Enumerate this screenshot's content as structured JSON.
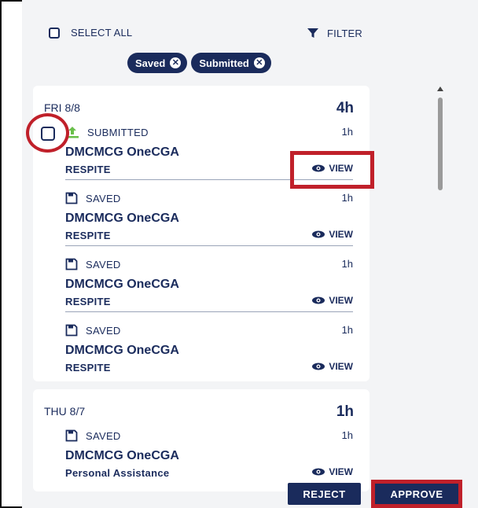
{
  "toolbar": {
    "select_all_label": "SELECT ALL",
    "filter_label": "FILTER"
  },
  "filter_chips": [
    {
      "label": "Saved"
    },
    {
      "label": "Submitted"
    }
  ],
  "days": [
    {
      "day": "FRI 8/8",
      "total": "4h",
      "entries": [
        {
          "status": "SUBMITTED",
          "hours": "1h",
          "name": "DMCMCG OneCGA",
          "service": "RESPITE",
          "view_label": "VIEW"
        },
        {
          "status": "SAVED",
          "hours": "1h",
          "name": "DMCMCG OneCGA",
          "service": "RESPITE",
          "view_label": "VIEW"
        },
        {
          "status": "SAVED",
          "hours": "1h",
          "name": "DMCMCG OneCGA",
          "service": "RESPITE",
          "view_label": "VIEW"
        },
        {
          "status": "SAVED",
          "hours": "1h",
          "name": "DMCMCG OneCGA",
          "service": "RESPITE",
          "view_label": "VIEW"
        }
      ]
    },
    {
      "day": "THU 8/7",
      "total": "1h",
      "entries": [
        {
          "status": "SAVED",
          "hours": "1h",
          "name": "DMCMCG OneCGA",
          "service": "Personal Assistance",
          "view_label": "VIEW"
        }
      ]
    }
  ],
  "actions": {
    "reject_label": "REJECT",
    "approve_label": "APPROVE"
  },
  "icons": {
    "filter": "filter-icon",
    "submitted": "upload-icon",
    "saved": "save-disk-icon",
    "view": "eye-icon",
    "chip_remove": "close-circle-icon"
  },
  "colors": {
    "navy": "#1a2b5c",
    "submitted_green": "#6abf4b",
    "annotation_red": "#c0202a",
    "panel_bg": "#f3f4f6"
  }
}
